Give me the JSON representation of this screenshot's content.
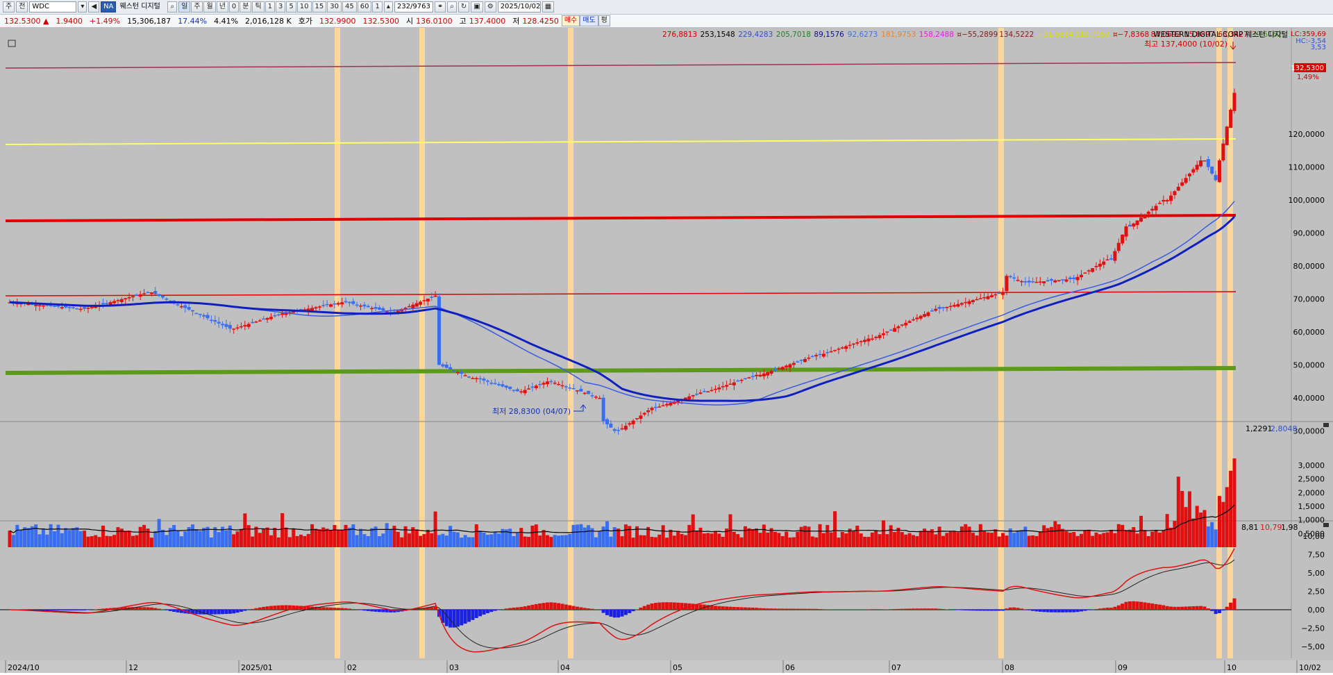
{
  "toolbar": {
    "view_label": "주",
    "all_label": "전",
    "code": "WDC",
    "na_badge": "NA",
    "stock_name": "웨스턴 디지털",
    "period_buttons": [
      "일",
      "주",
      "월",
      "년",
      "0",
      "분",
      "틱",
      "1",
      "3",
      "5",
      "10",
      "15",
      "30",
      "45",
      "60",
      "1"
    ],
    "count": "232",
    "total": "/9763",
    "date": "2025/10/02"
  },
  "quote": {
    "price": "132.5300",
    "arrow": "▲",
    "change": "1.9400",
    "change_pct": "+1.49%",
    "volume": "15,306,187",
    "volume_pct": "17.44%",
    "turnover_pct": "4.41%",
    "amount": "2,016,128",
    "amount_unit": "K",
    "hoga_label": "호가",
    "ask": "132.9900",
    "bid": "132.5300",
    "open_label": "시",
    "open": "136.0100",
    "high_label": "고",
    "high": "137.4000",
    "low_label": "저",
    "low": "128.4250",
    "buy_label": "매수",
    "sell_label": "매도",
    "eq_label": "평"
  },
  "legend": {
    "values": [
      {
        "text": "276,8813",
        "color": "#cc0000"
      },
      {
        "text": "253,1548",
        "color": "#000000"
      },
      {
        "text": "229,4283",
        "color": "#3050d0"
      },
      {
        "text": "205,7018",
        "color": "#208020"
      },
      {
        "text": "89,1576",
        "color": "#101080"
      },
      {
        "text": "92,6273",
        "color": "#4070e0"
      },
      {
        "text": "181,9753",
        "color": "#f08020"
      },
      {
        "text": "158,2488",
        "color": "#e020e0"
      },
      {
        "text": "¤−55,2899",
        "color": "#802020"
      },
      {
        "text": "134,5222",
        "color": "#802020"
      },
      {
        "text": "−31,5634",
        "color": "#e0e000"
      },
      {
        "text": "110,7957",
        "color": "#e0e000"
      },
      {
        "text": "¤−7,8368",
        "color": "#cc0000"
      },
      {
        "text": "87,0692",
        "color": "#cc0000"
      },
      {
        "text": "15,8897",
        "color": "#cc0000"
      },
      {
        "text": "63,3427",
        "color": "#cc0000"
      },
      {
        "text": "39,6162",
        "color": "#409020"
      }
    ],
    "corp": "WESTERN DIGITAL CORP  웨스턴 디지털"
  },
  "price_axis": {
    "ticks": [
      "120,0000",
      "110,0000",
      "100,0000",
      "90,0000",
      "80,0000",
      "70,0000",
      "60,0000",
      "50,0000",
      "40,0000",
      "30,0000"
    ],
    "lc": "LC:359,69",
    "hc": "HC:-3,54",
    "hc2": "3,53",
    "current": "132,5300",
    "pct": "1,49%"
  },
  "annotations": {
    "high": "최고 137,4000 (10/02)",
    "low": "최저 28,8300 (04/07)"
  },
  "volume_panel": {
    "header": [
      "1,2291",
      "2,8048"
    ],
    "ticks": [
      "3,0000",
      "2,5000",
      "2,0000",
      "1,5000",
      "1,0000",
      "0,5000"
    ]
  },
  "macd_panel": {
    "header": [
      "8,81",
      "10,79",
      "1,98"
    ],
    "ticks": [
      "10,00",
      "7,50",
      "5,00",
      "2,50",
      "0,00",
      "−2,50",
      "−5,00"
    ]
  },
  "x_axis": [
    "2024/10",
    "12",
    "2025/01",
    "02",
    "03",
    "04",
    "05",
    "06",
    "07",
    "08",
    "09",
    "10",
    "10/02"
  ],
  "colors": {
    "up": "#e01010",
    "down": "#3a6ef0",
    "ma": "#1020c0",
    "highlight": "#fbd79c"
  }
}
